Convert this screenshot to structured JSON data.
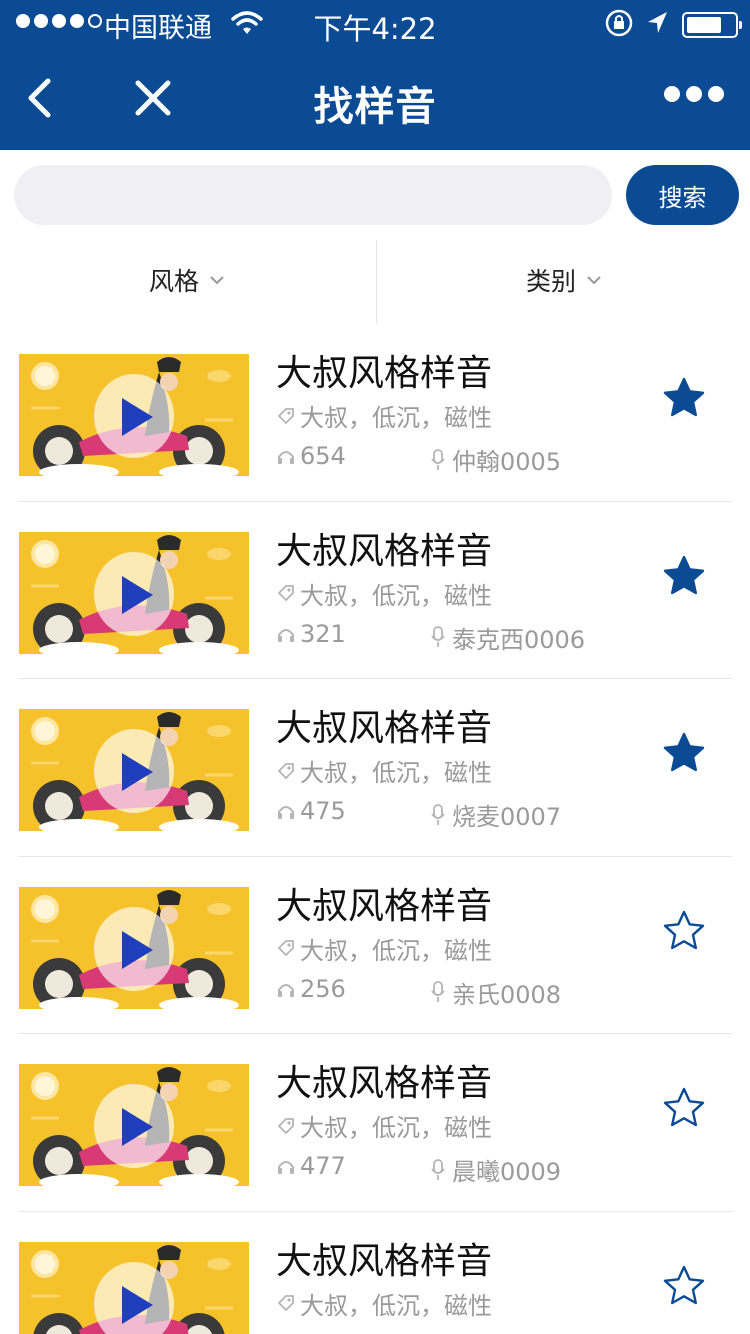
{
  "status_bar": {
    "carrier": "中国联通",
    "time": "下午4:22"
  },
  "nav": {
    "title": "找样音"
  },
  "search": {
    "placeholder": "",
    "button_label": "搜索"
  },
  "filters": {
    "style_label": "风格",
    "category_label": "类别"
  },
  "colors": {
    "brand": "#0b4b94",
    "thumbnail_bg": "#f6c22c",
    "muted_text": "#9a9a9a"
  },
  "items": [
    {
      "title": "大叔风格样音",
      "tags": "大叔，低沉，磁性",
      "plays": "654",
      "author": "仲翰0005",
      "favorited": true
    },
    {
      "title": "大叔风格样音",
      "tags": "大叔，低沉，磁性",
      "plays": "321",
      "author": "泰克西0006",
      "favorited": true
    },
    {
      "title": "大叔风格样音",
      "tags": "大叔，低沉，磁性",
      "plays": "475",
      "author": "烧麦0007",
      "favorited": true
    },
    {
      "title": "大叔风格样音",
      "tags": "大叔，低沉，磁性",
      "plays": "256",
      "author": "亲氏0008",
      "favorited": false
    },
    {
      "title": "大叔风格样音",
      "tags": "大叔，低沉，磁性",
      "plays": "477",
      "author": "晨曦0009",
      "favorited": false
    },
    {
      "title": "大叔风格样音",
      "tags": "大叔，低沉，磁性",
      "plays": "",
      "author": "",
      "favorited": false
    }
  ]
}
